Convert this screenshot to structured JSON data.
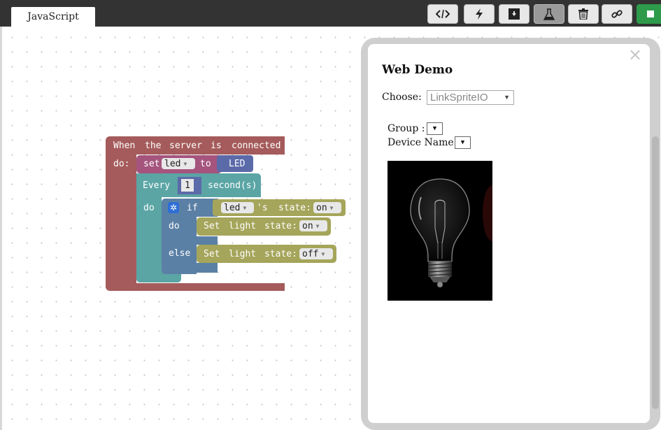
{
  "tab": {
    "label": "JavaScript"
  },
  "toolbar": {
    "buttons": [
      {
        "icon": "code-icon",
        "active": false
      },
      {
        "icon": "lightning-icon",
        "active": false
      },
      {
        "icon": "download-box-icon",
        "active": false
      },
      {
        "icon": "flask-icon",
        "active": true
      },
      {
        "icon": "trash-icon",
        "active": false
      },
      {
        "icon": "link-icon",
        "active": false
      },
      {
        "icon": "stop-icon",
        "color": "#2e9b4a"
      }
    ]
  },
  "blocks": {
    "event": {
      "w1": "When",
      "w2": "the",
      "w3": "server",
      "w4": "is",
      "w5": "connected",
      "do": "do:"
    },
    "set": {
      "set": "set",
      "var": "led",
      "to": "to",
      "value": "LED"
    },
    "every": {
      "every": "Every",
      "count": "1",
      "unit": "second(s)",
      "do": "do"
    },
    "if": {
      "if": "if",
      "device": "led",
      "apostrophe": "'s",
      "state_label": "state:",
      "state": "on",
      "do": "do",
      "else": "else"
    },
    "set_on": {
      "set": "Set",
      "target": "light",
      "state_label": "state:",
      "state": "on"
    },
    "set_off": {
      "set": "Set",
      "target": "light",
      "state_label": "state:",
      "state": "off"
    }
  },
  "colors": {
    "event": "#a55b5b",
    "set": "#a5547e",
    "variable": "#5b6aa8",
    "loop": "#5ba5a5",
    "logic": "#5b80a5",
    "device": "#a5a55b"
  },
  "panel": {
    "close": "×",
    "title": "Web Demo",
    "choose_label": "Choose:",
    "choose_value": "LinkSpriteIO",
    "group_label": "Group :",
    "device_label": "Device Name:"
  }
}
